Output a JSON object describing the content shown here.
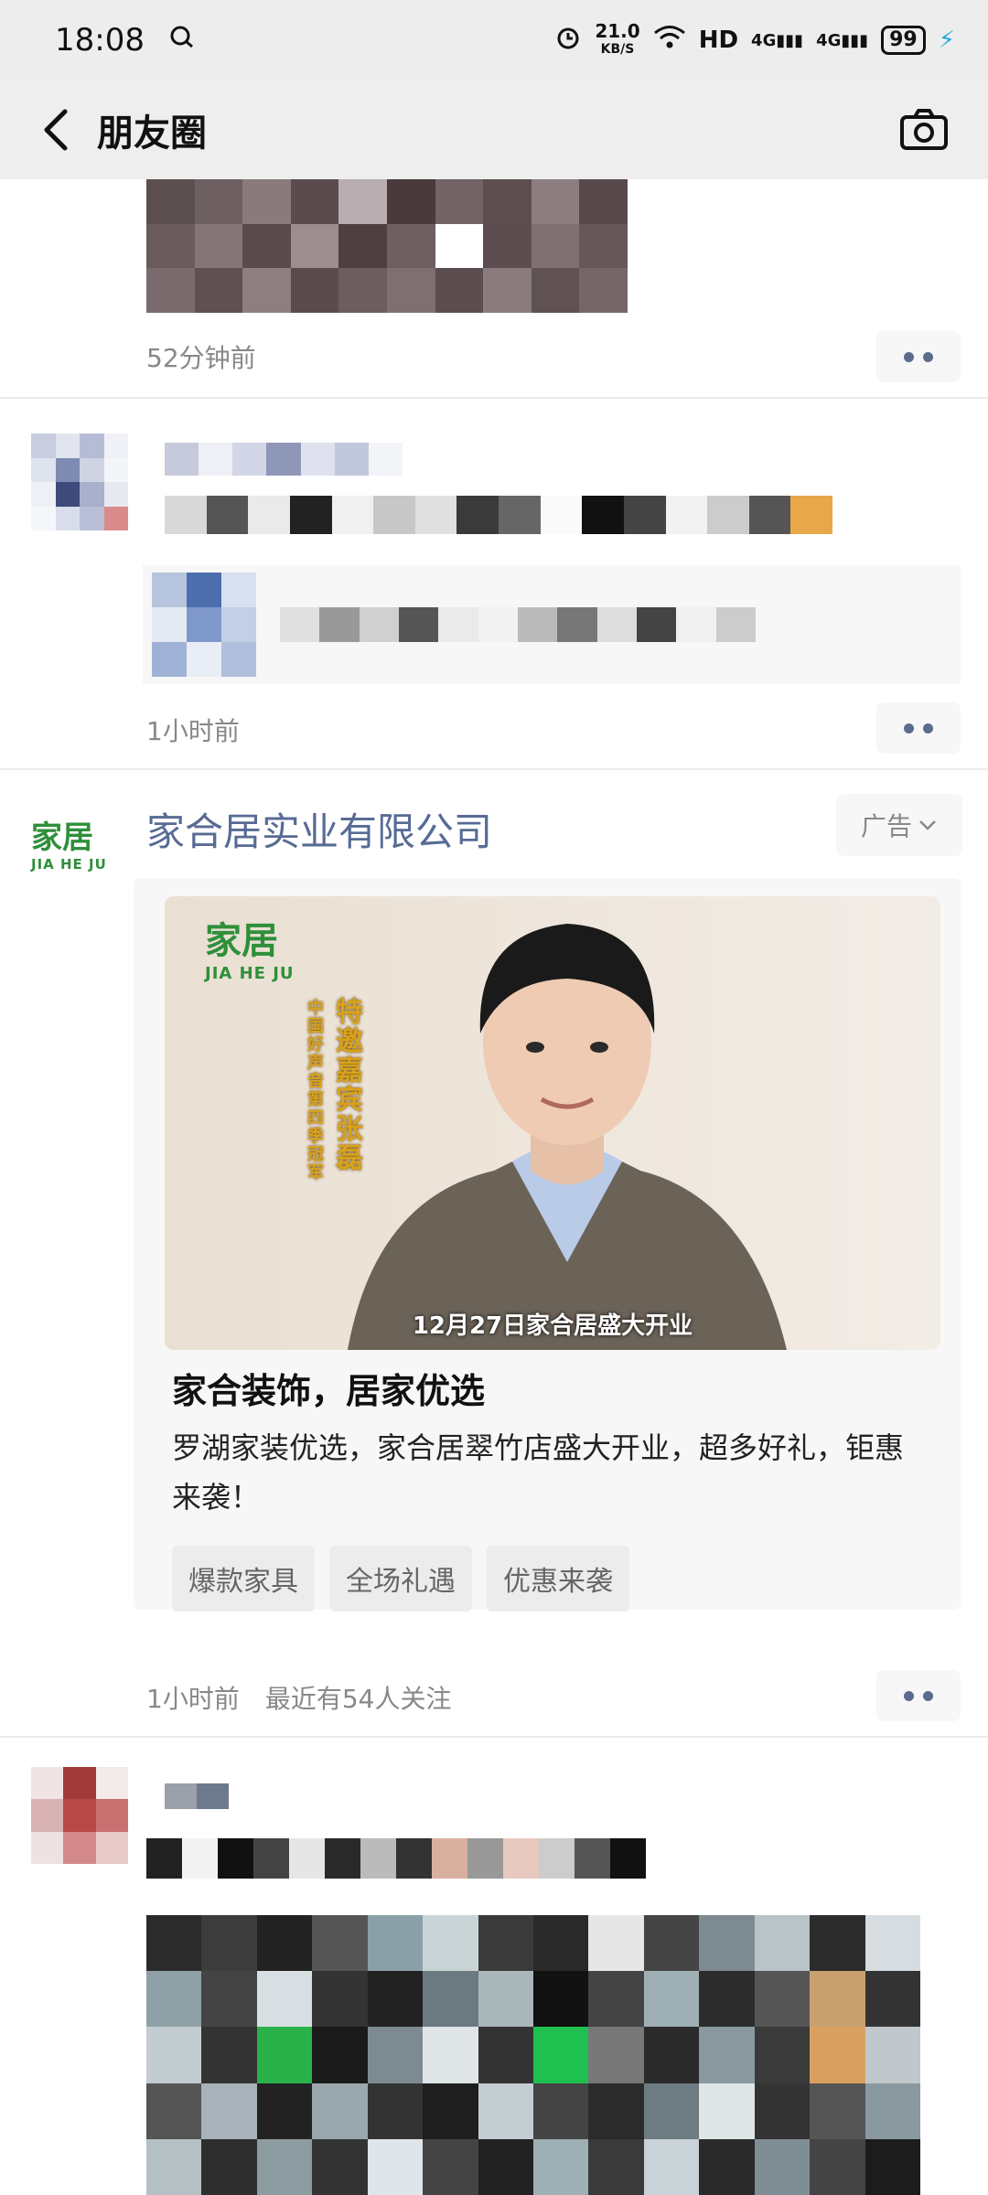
{
  "status": {
    "time": "18:08",
    "speed_value": "21.0",
    "speed_unit": "KB/S",
    "network_1": "HD",
    "network_2": "4G",
    "network_3": "4G",
    "battery": "99"
  },
  "nav": {
    "title": "朋友圈",
    "back_icon": "chevron-left-icon",
    "camera_icon": "camera-icon"
  },
  "posts": [
    {
      "time": "52分钟前"
    },
    {
      "time": "1小时前"
    },
    {
      "advertiser": "家合居实业有限公司",
      "ad_label": "广告",
      "logo_text": "家居",
      "logo_sub": "JIA HE JU",
      "video_logo_text": "家居",
      "video_logo_sub": "JIA HE JU",
      "video_vertical_1": "特邀嘉宾张磊",
      "video_vertical_2": "中国好声音第四季冠军",
      "video_caption": "12月27日家合居盛大开业",
      "headline": "家合装饰，居家优选",
      "description": "罗湖家装优选，家合居翠竹店盛大开业，超多好礼，钜惠来袭！",
      "chips": [
        "爆款家具",
        "全场礼遇",
        "优惠来袭"
      ],
      "time": "1小时前",
      "followers": "最近有54人关注"
    }
  ],
  "colors": {
    "link_blue": "#576b95",
    "brand_green": "#2f8f3a",
    "brand_red": "#d9332b"
  }
}
